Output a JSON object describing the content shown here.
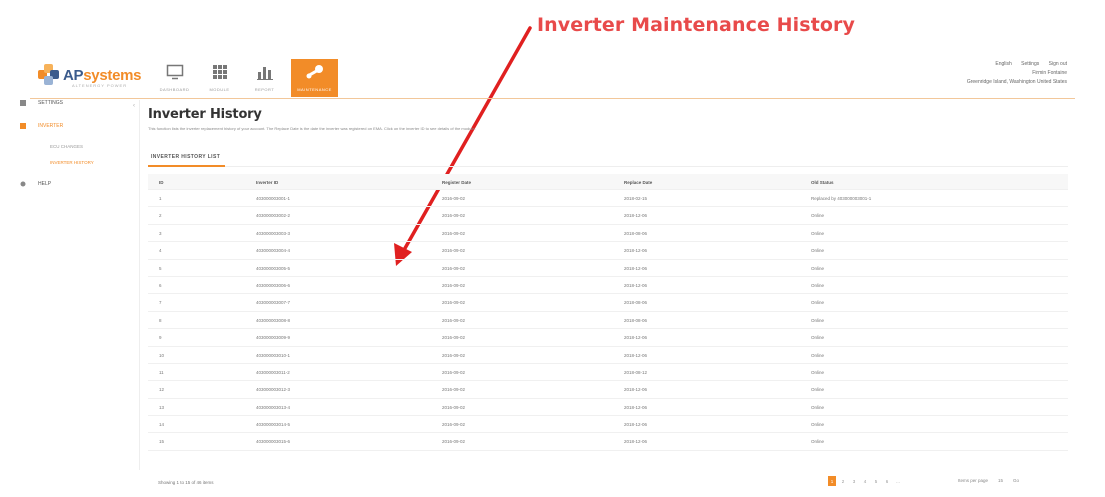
{
  "annotation": {
    "text": "Inverter Maintenance History",
    "color": "#e84a4a"
  },
  "brand": {
    "name_ap": "AP",
    "name_rest": "systems",
    "tagline": "ALTENERGY POWER",
    "color": "#f28c28"
  },
  "nav": [
    {
      "label": "DASHBOARD",
      "icon": "monitor-icon",
      "active": false
    },
    {
      "label": "MODULE",
      "icon": "grid-icon",
      "active": false
    },
    {
      "label": "REPORT",
      "icon": "bar-chart-icon",
      "active": false
    },
    {
      "label": "MAINTENANCE",
      "icon": "wrench-icon",
      "active": true
    }
  ],
  "header_right": {
    "language": "English",
    "settings": "Settings",
    "sign_out": "Sign out",
    "user": "Firmin Fontaine",
    "location": "Greenridge Island, Washington United States"
  },
  "sidebar": {
    "items": [
      {
        "label": "SETTINGS",
        "icon": "settings-icon"
      },
      {
        "label": "INVERTER",
        "icon": "inverter-icon",
        "active": true
      },
      {
        "label": "HELP",
        "icon": "help-icon"
      }
    ],
    "sub_items": [
      {
        "label": "ECU CHANGES",
        "active": false
      },
      {
        "label": "INVERTER HISTORY",
        "active": true
      }
    ]
  },
  "main": {
    "title": "Inverter History",
    "description": "This function lists the inverter replacement history of your account. The Replace Date is the date the inverter was registered on EMA. Click on the inverter ID to see details of the module.",
    "tab": "INVERTER HISTORY LIST"
  },
  "table": {
    "headers": [
      "ID",
      "Inverter ID",
      "Register Date",
      "Replace Date",
      "Old Status"
    ],
    "rows": [
      [
        "1",
        "403000003001-1",
        "2016-09-02",
        "2018-02-15",
        "Replaced by 403000003001-1"
      ],
      [
        "2",
        "403000003002-2",
        "2016-09-02",
        "2018-12-06",
        "Online"
      ],
      [
        "3",
        "403000003003-3",
        "2016-09-02",
        "2018-08-06",
        "Online"
      ],
      [
        "4",
        "403000003004-4",
        "2016-09-02",
        "2018-12-06",
        "Online"
      ],
      [
        "5",
        "403000003005-5",
        "2016-09-02",
        "2018-12-06",
        "Online"
      ],
      [
        "6",
        "403000003006-6",
        "2016-09-02",
        "2018-12-06",
        "Online"
      ],
      [
        "7",
        "403000003007-7",
        "2016-09-02",
        "2018-08-06",
        "Online"
      ],
      [
        "8",
        "403000003008-8",
        "2016-09-02",
        "2018-08-06",
        "Online"
      ],
      [
        "9",
        "403000003009-9",
        "2016-09-02",
        "2018-12-06",
        "Online"
      ],
      [
        "10",
        "403000003010-1",
        "2016-09-02",
        "2018-12-06",
        "Online"
      ],
      [
        "11",
        "403000003011-2",
        "2016-09-02",
        "2018-08-12",
        "Online"
      ],
      [
        "12",
        "403000003012-3",
        "2016-09-02",
        "2018-12-06",
        "Online"
      ],
      [
        "13",
        "403000003013-4",
        "2016-09-02",
        "2018-12-06",
        "Online"
      ],
      [
        "14",
        "403000003014-5",
        "2016-09-02",
        "2018-12-06",
        "Online"
      ],
      [
        "15",
        "403000003015-6",
        "2016-09-02",
        "2018-12-06",
        "Online"
      ]
    ]
  },
  "footer": {
    "showing": "Showing 1 to 15 of 46 items",
    "pages": [
      "1",
      "2",
      "3",
      "4",
      "5",
      "6",
      "..."
    ],
    "page_size": "Items per page",
    "page_size_value": "15",
    "go": "Go"
  }
}
